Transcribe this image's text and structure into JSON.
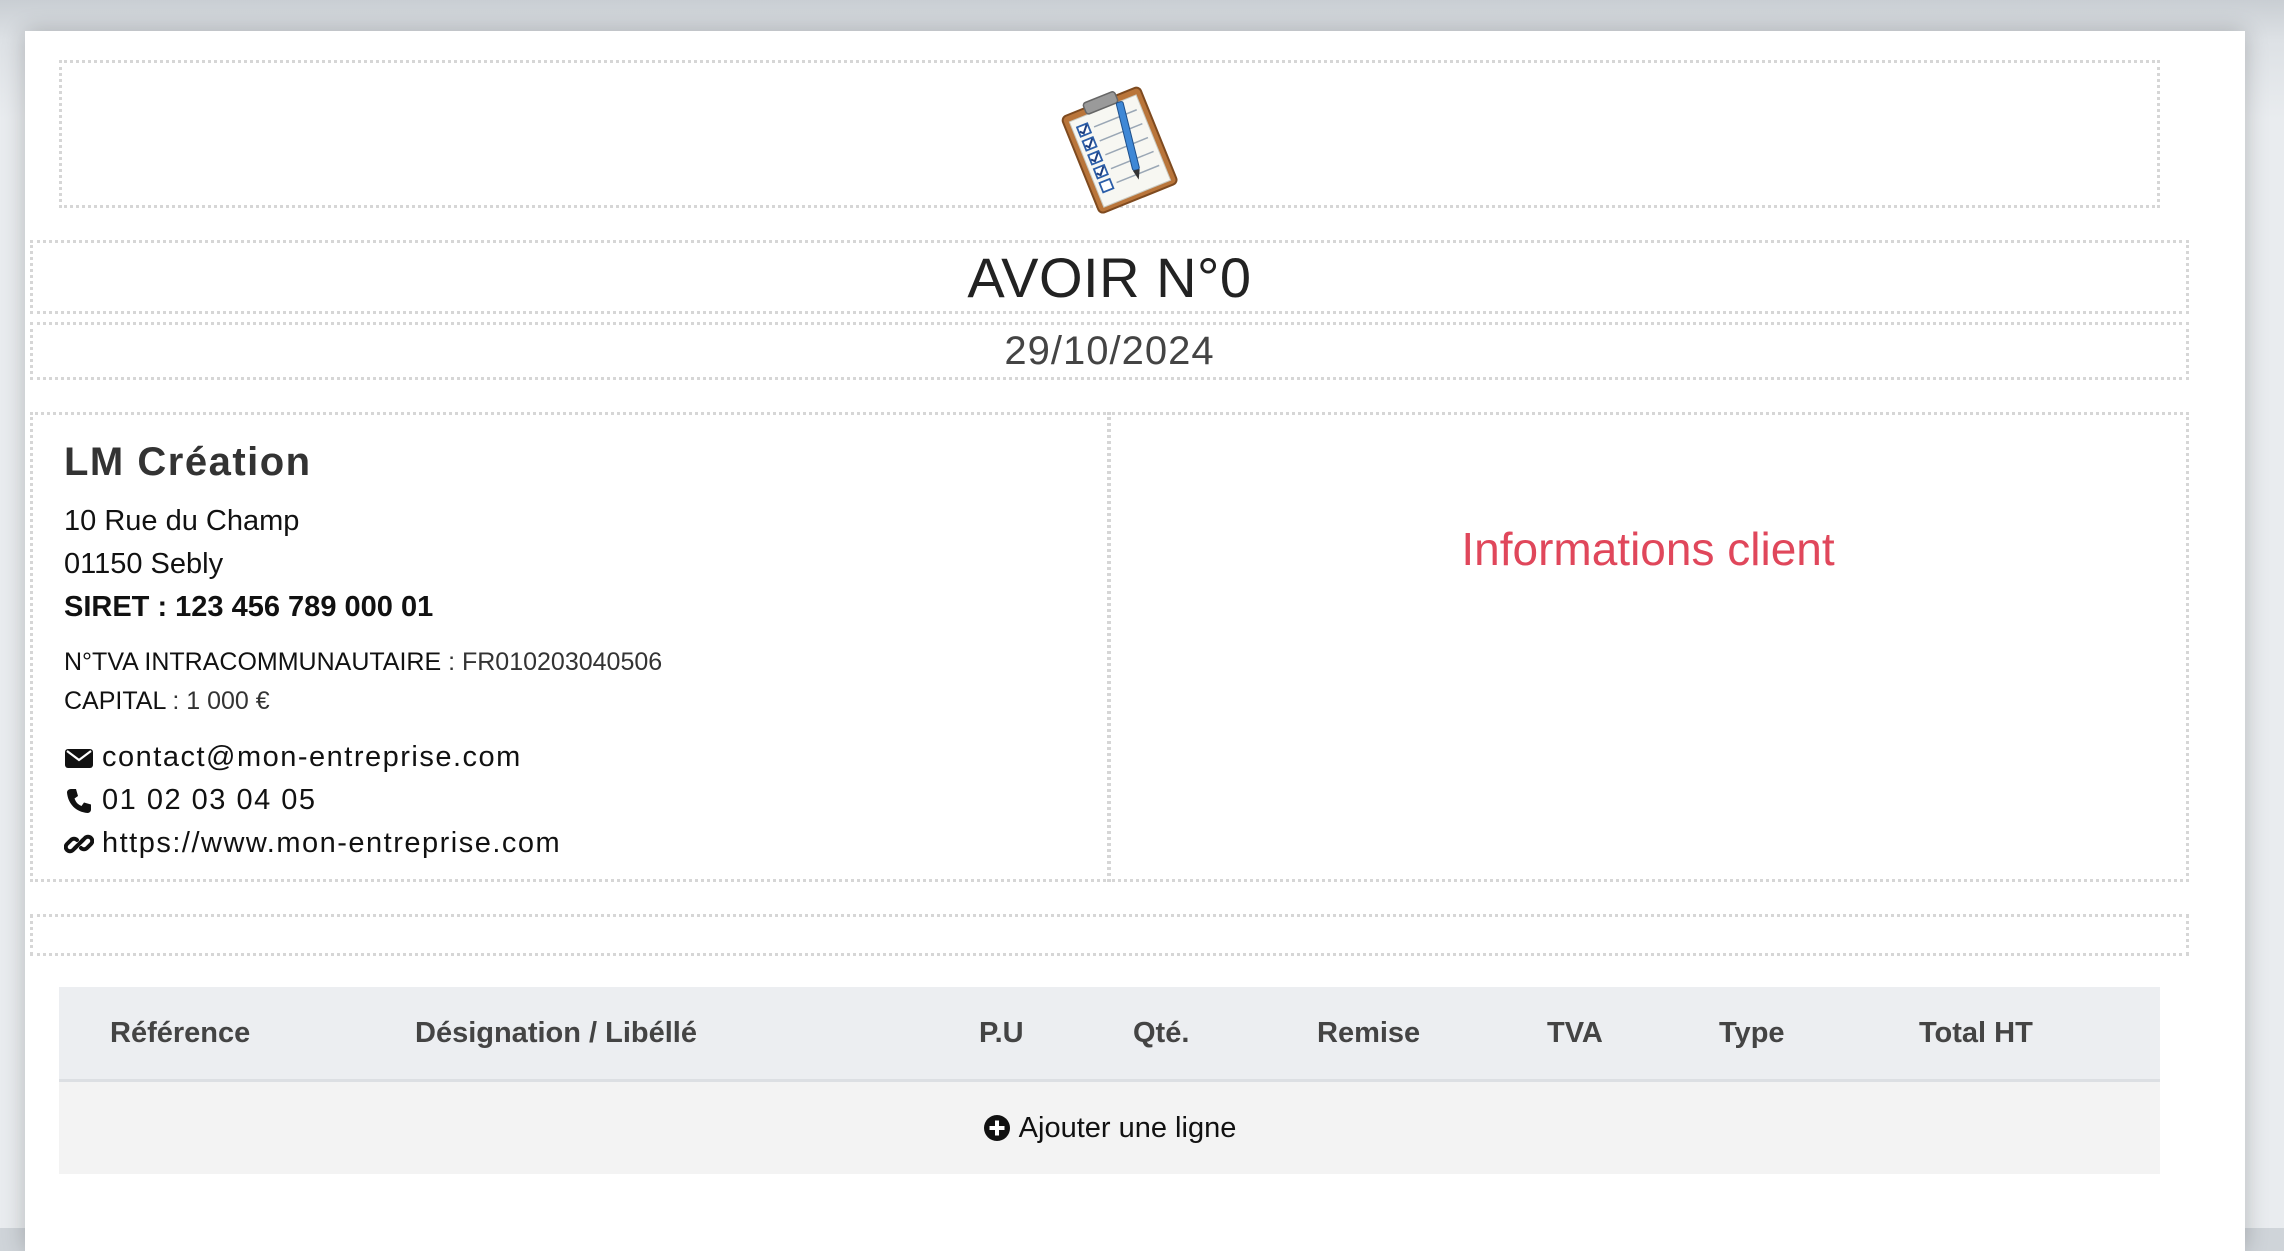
{
  "document": {
    "title": "AVOIR N°0",
    "date": "29/10/2024"
  },
  "company": {
    "name": "LM Création",
    "address_line1": "10 Rue du Champ",
    "address_line2": "01150 Sebly",
    "siret": "SIRET : 123 456 789 000 01",
    "tva_label": "N°TVA INTRACOMMUNAUTAIRE",
    "tva_value": " : FR010203040506",
    "capital_label": "CAPITAL",
    "capital_value": " : 1 000 €",
    "email": "contact@mon-entreprise.com",
    "phone": "01 02 03 04 05",
    "website": "https://www.mon-entreprise.com"
  },
  "client": {
    "placeholder": "Informations client"
  },
  "table": {
    "columns": [
      "Référence",
      "Désignation / Libéllé",
      "P.U",
      "Qté.",
      "Remise",
      "TVA",
      "Type",
      "Total HT"
    ],
    "add_line_label": "Ajouter une ligne"
  },
  "icons": {
    "logo": "clipboard-checklist-icon",
    "email": "envelope-icon",
    "phone": "phone-icon",
    "website": "link-icon",
    "add": "plus-circle-icon"
  },
  "colors": {
    "client_placeholder": "#e0475b",
    "table_header_bg": "#eceef1",
    "table_body_bg": "#f3f3f3"
  }
}
